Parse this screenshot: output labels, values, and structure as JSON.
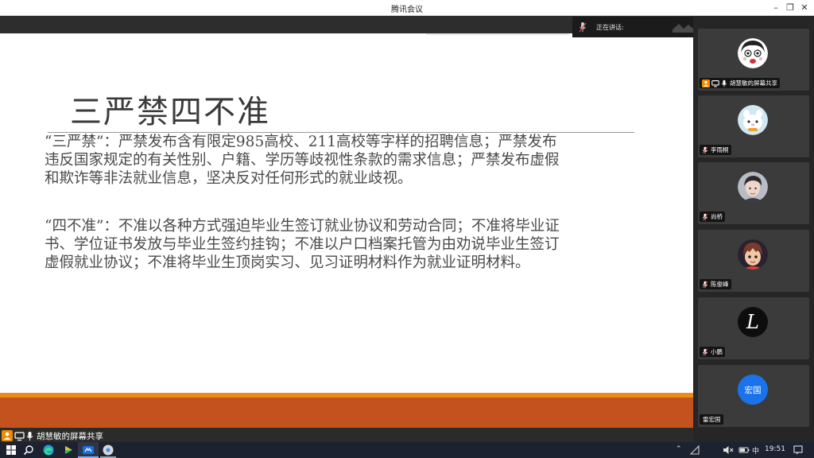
{
  "window": {
    "title": "腾讯会议"
  },
  "speaking": {
    "label": "正在讲话:"
  },
  "slide": {
    "title": "三严禁四不准",
    "paragraph1": "“三严禁”：严禁发布含有限定985高校、211高校等字样的招聘信息；严禁发布违反国家规定的有关性别、户籍、学历等歧视性条款的需求信息；严禁发布虚假和欺诈等非法就业信息，坚决反对任何形式的就业歧视。",
    "paragraph2": "“四不准”：不准以各种方式强迫毕业生签订就业协议和劳动合同；不准将毕业证书、学位证书发放与毕业生签约挂钩；不准以户口档案托管为由劝说毕业生签订虚假就业协议；不准将毕业生顶岗实习、见习证明材料作为就业证明材料。"
  },
  "share_indicator": {
    "label": "胡慧敏的屏幕共享"
  },
  "participants": [
    {
      "name": "胡慧敏的屏幕共享",
      "avatar": "cartoon-face-icon",
      "sharing": true
    },
    {
      "name": "李雨桐",
      "avatar": "cartoon-animal-icon",
      "sharing": false
    },
    {
      "name": "尚桥",
      "avatar": "person-photo-icon",
      "sharing": false
    },
    {
      "name": "陈俊峰",
      "avatar": "anime-character-icon",
      "sharing": false
    },
    {
      "name": "小鹏",
      "avatar": "letter-L-icon",
      "avatar_text": "L",
      "sharing": false
    },
    {
      "name": "雷宏国",
      "avatar": "initials-avatar",
      "avatar_text": "宏国",
      "sharing": false
    }
  ],
  "taskbar": {
    "ime": "中",
    "time": "19:51"
  },
  "colors": {
    "accent_orange": "#ec8a1a",
    "slide_red": "#c4521f",
    "avatar_blue": "#1a73e8",
    "share_orange": "#f08a00"
  }
}
